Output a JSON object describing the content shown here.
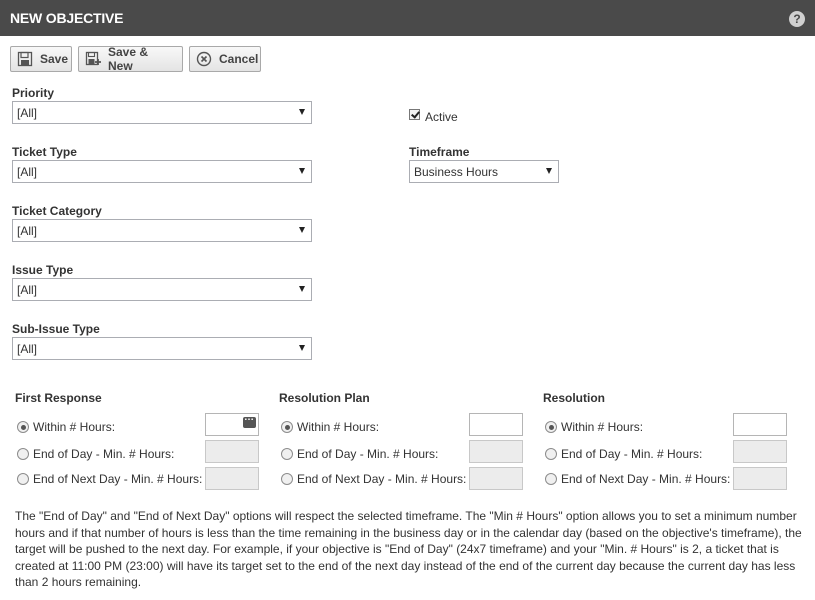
{
  "header": {
    "title": "NEW OBJECTIVE",
    "help_glyph": "?"
  },
  "toolbar": {
    "save_label": "Save",
    "save_new_label": "Save & New",
    "cancel_label": "Cancel"
  },
  "form": {
    "priority": {
      "label": "Priority",
      "value": "[All]"
    },
    "ticket_type": {
      "label": "Ticket Type",
      "value": "[All]"
    },
    "ticket_category": {
      "label": "Ticket Category",
      "value": "[All]"
    },
    "issue_type": {
      "label": "Issue Type",
      "value": "[All]"
    },
    "sub_issue_type": {
      "label": "Sub-Issue Type",
      "value": "[All]"
    },
    "active": {
      "label": "Active",
      "checked": true
    },
    "timeframe": {
      "label": "Timeframe",
      "value": "Business Hours"
    }
  },
  "targets": [
    {
      "title": "First Response",
      "options": [
        "Within # Hours:",
        "End of Day - Min. # Hours:",
        "End of Next Day - Min. # Hours:"
      ],
      "selected": 0
    },
    {
      "title": "Resolution Plan",
      "options": [
        "Within # Hours:",
        "End of Day - Min. # Hours:",
        "End of Next Day - Min. # Hours:"
      ],
      "selected": 0
    },
    {
      "title": "Resolution",
      "options": [
        "Within # Hours:",
        "End of Day - Min. # Hours:",
        "End of Next Day - Min. # Hours:"
      ],
      "selected": 0
    }
  ],
  "note": "The \"End of Day\" and \"End of Next Day\" options will respect the selected timeframe. The \"Min # Hours\" option allows you to set a minimum number hours and if that number of hours is less than the time remaining in the business day or in the calendar day (based on the objective's timeframe), the target will be pushed to the next day. For example, if your objective is \"End of Day\" (24x7 timeframe) and your \"Min. # Hours\" is 2, a ticket that is created at 11:00 PM (23:00) will have its target set to the end of the next day instead of the end of the current day because the current day has less than 2 hours remaining.",
  "colors": {
    "header_bg": "#4a4a4a",
    "header_text": "#ffffff"
  }
}
